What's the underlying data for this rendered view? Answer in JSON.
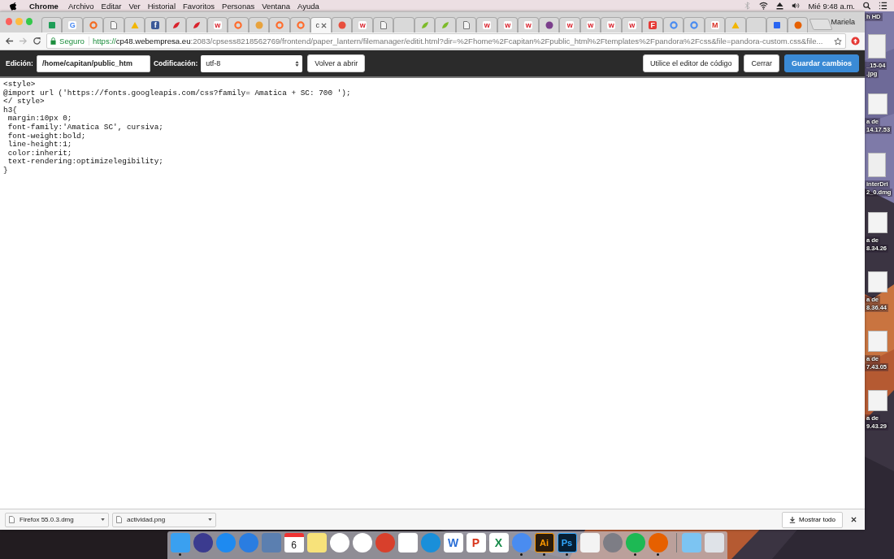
{
  "menu_bar": {
    "app": "Chrome",
    "items": [
      "Archivo",
      "Editar",
      "Ver",
      "Historial",
      "Favoritos",
      "Personas",
      "Ventana",
      "Ayuda"
    ],
    "clock": "Mié 9:48 a.m."
  },
  "tabs": [
    {
      "selected": false
    },
    {
      "glyph": "G",
      "selected": false
    },
    {
      "selected": false
    },
    {
      "selected": false
    },
    {
      "selected": false
    },
    {
      "glyph": "f",
      "selected": false
    },
    {
      "selected": false
    },
    {
      "selected": false
    },
    {
      "glyph": "w",
      "selected": false
    },
    {
      "selected": false
    },
    {
      "selected": false
    },
    {
      "selected": false
    },
    {
      "selected": false
    },
    {
      "title": "c",
      "selected": true
    },
    {
      "selected": false
    },
    {
      "glyph": "w",
      "selected": false
    },
    {
      "selected": false
    },
    {
      "selected": false
    },
    {
      "selected": false
    },
    {
      "selected": false
    },
    {
      "selected": false
    },
    {
      "glyph": "w",
      "selected": false
    },
    {
      "glyph": "w",
      "selected": false
    },
    {
      "glyph": "w",
      "selected": false
    },
    {
      "selected": false
    },
    {
      "glyph": "w",
      "selected": false
    },
    {
      "glyph": "w",
      "selected": false
    },
    {
      "glyph": "w",
      "selected": false
    },
    {
      "glyph": "w",
      "selected": false
    },
    {
      "glyph": "F",
      "selected": false
    },
    {
      "selected": false
    },
    {
      "selected": false
    },
    {
      "glyph": "M",
      "selected": false
    },
    {
      "selected": false
    },
    {
      "selected": false
    },
    {
      "selected": false
    },
    {
      "selected": false
    }
  ],
  "profile": "Mariela",
  "address_bar": {
    "security": "Seguro",
    "scheme": "https://",
    "host": "cp48.webempresa.eu",
    "path": ":2083/cpsess8218562769/frontend/paper_lantern/filemanager/editit.html?dir=%2Fhome%2Fcapitan%2Fpublic_html%2Ftemplates%2Fpandora%2Fcss&file=pandora-custom.css&file..."
  },
  "editor_toolbar": {
    "path_label": "Edición:",
    "path_value": "/home/capitan/public_htm",
    "encoding_label": "Codificación:",
    "encoding": "utf-8",
    "buttons": [
      {
        "label": "Volver a abrir",
        "kind": "default"
      },
      {
        "label": "Utilice el editor de código",
        "kind": "default"
      },
      {
        "label": "Cerrar",
        "kind": "default"
      },
      {
        "label": "Guardar cambios",
        "kind": "primary"
      }
    ]
  },
  "code_lines": [
    "<style>",
    "@import url ('https://fonts.googleapis.com/css?family= Amatica + SC: 700 ');",
    "</ style>",
    "h3{",
    " margin:10px 0;",
    " font-family:'Amatica SC', cursiva;",
    " font-weight:bold;",
    " line-height:1;",
    " color:inherit;",
    " text-rendering:optimizelegibility;",
    "}"
  ],
  "downloads": {
    "items": [
      "Firefox 55.0.3.dmg",
      "actividad.png"
    ],
    "show_all": "Mostrar todo"
  },
  "desktop_items": [
    {
      "lines": [
        "h HD"
      ],
      "kind": "label"
    },
    {
      "lines": [
        "_15-04",
        ".jpg"
      ],
      "kind": "file"
    },
    {
      "lines": [
        "a de",
        "14.17.53"
      ],
      "kind": "shot"
    },
    {
      "lines": [
        "interDri",
        "2_0.dmg"
      ],
      "kind": "file"
    },
    {
      "lines": [
        "a de",
        "8.34.26"
      ],
      "kind": "shot"
    },
    {
      "lines": [
        "a de",
        "8.36.44"
      ],
      "kind": "shot"
    },
    {
      "lines": [
        "a de",
        "7.43.05"
      ],
      "kind": "shot"
    },
    {
      "lines": [
        "a de",
        "9.43.29"
      ],
      "kind": "shot"
    }
  ],
  "dock": [
    {
      "running": true
    },
    {
      "running": false
    },
    {
      "running": false
    },
    {
      "running": false
    },
    {
      "running": false
    },
    {
      "glyph": "6",
      "running": false
    },
    {
      "running": false
    },
    {
      "running": false
    },
    {
      "running": false
    },
    {
      "running": false
    },
    {
      "running": false
    },
    {
      "running": false
    },
    {
      "glyph": "W",
      "running": false
    },
    {
      "glyph": "P",
      "running": false
    },
    {
      "glyph": "X",
      "running": false
    },
    {
      "running": true
    },
    {
      "glyph": "Ai",
      "running": true
    },
    {
      "glyph": "Ps",
      "running": true
    },
    {
      "running": false
    },
    {
      "running": false
    },
    {
      "running": true
    },
    {
      "running": true
    },
    {
      "running": false
    },
    {
      "running": false
    }
  ]
}
